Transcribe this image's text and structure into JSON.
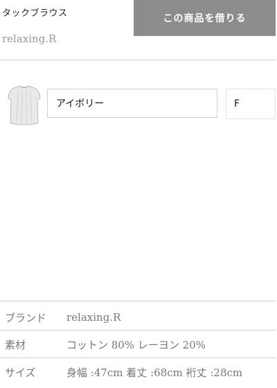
{
  "product": {
    "title": "タックブラウス",
    "brand": "relaxing.R",
    "rent_button_label": "この商品を借りる",
    "thumbnail_alt": "ブラウス"
  },
  "selection": {
    "color": "アイボリー",
    "size": "F"
  },
  "specs": [
    {
      "label": "ブランド",
      "value": "relaxing.R"
    },
    {
      "label": "素材",
      "value": "コットン 80% レーヨン 20%"
    },
    {
      "label": "サイズ",
      "value": "身幅 :47cm 着丈 :68cm 裄丈 :28cm"
    }
  ],
  "colors": {
    "button_bg": "#8c8c8c",
    "divider": "#cfcfcf",
    "muted_text": "#777777"
  }
}
